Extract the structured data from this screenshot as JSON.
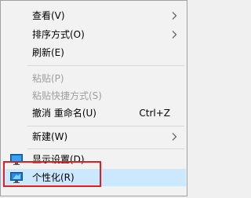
{
  "menu": {
    "items": [
      {
        "label": "查看(V)",
        "has_submenu": true,
        "enabled": true
      },
      {
        "label": "排序方式(O)",
        "has_submenu": true,
        "enabled": true
      },
      {
        "label": "刷新(E)",
        "enabled": true
      },
      {
        "label": "粘贴(P)",
        "enabled": false
      },
      {
        "label": "粘贴快捷方式(S)",
        "enabled": false
      },
      {
        "label": "撤消 重命名(U)",
        "shortcut": "Ctrl+Z",
        "enabled": true
      },
      {
        "label": "新建(W)",
        "has_submenu": true,
        "enabled": true
      },
      {
        "label": "显示设置(D)",
        "icon": "display-settings-icon",
        "enabled": true
      },
      {
        "label": "个性化(R)",
        "icon": "personalize-icon",
        "enabled": true,
        "highlighted": true
      }
    ]
  },
  "annotation": {
    "highlight_color": "#e02020",
    "highlighted_item": "个性化(R)"
  },
  "colors": {
    "menu_background": "#f2f2f2",
    "disabled_text": "#9e9e9e",
    "hover_background": "#cce8ff"
  }
}
